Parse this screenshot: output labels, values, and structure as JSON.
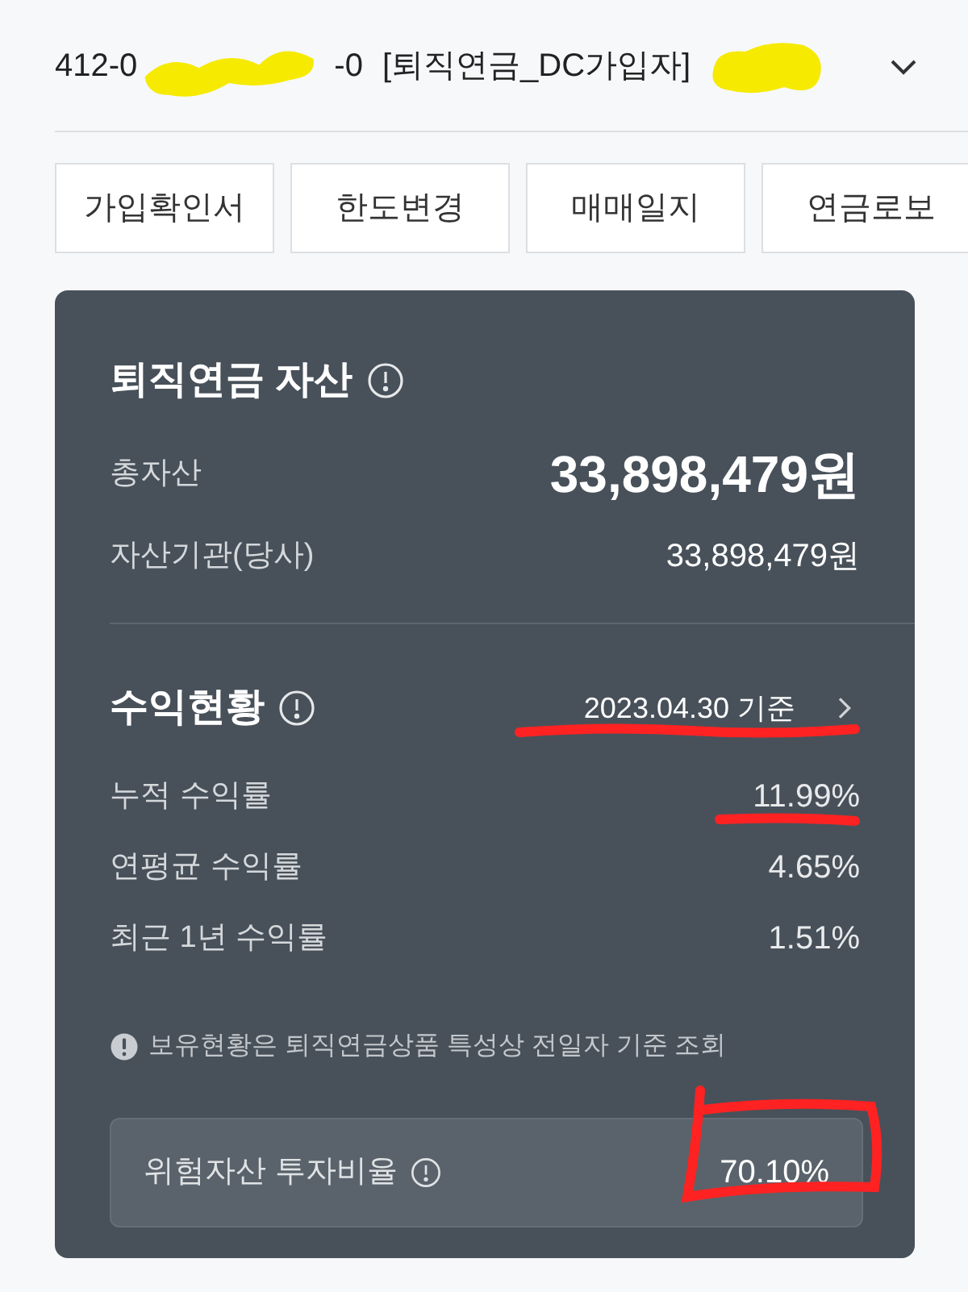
{
  "account": {
    "prefix": "412-0",
    "suffix": "-0",
    "type": "[퇴직연금_DC가입자]"
  },
  "buttons": [
    "가입확인서",
    "한도변경",
    "매매일지",
    "연금로보"
  ],
  "assets": {
    "title": "퇴직연금 자산",
    "total_label": "총자산",
    "total_value": "33,898,479원",
    "rows": [
      {
        "label": "자산기관(당사)",
        "value": "33,898,479원"
      }
    ]
  },
  "returns": {
    "title": "수익현황",
    "date": "2023.04.30 기준",
    "rows": [
      {
        "label": "누적 수익률",
        "value": "11.99%"
      },
      {
        "label": "연평균 수익률",
        "value": "4.65%"
      },
      {
        "label": "최근 1년 수익률",
        "value": "1.51%"
      }
    ]
  },
  "note": "보유현황은 퇴직연금상품 특성상 전일자 기준 조회",
  "risk": {
    "label": "위험자산 투자비율",
    "value": "70.10%"
  }
}
